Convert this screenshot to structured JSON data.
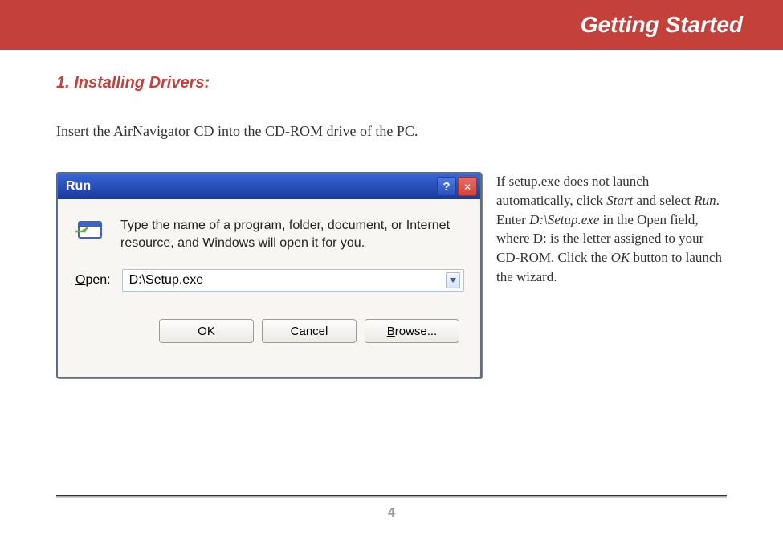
{
  "header": {
    "title": "Getting Started"
  },
  "section": {
    "heading": "1. Installing Drivers:"
  },
  "intro": "Insert the AirNavigator CD into the CD-ROM drive of the PC.",
  "dialog": {
    "title": "Run",
    "help_symbol": "?",
    "close_symbol": "×",
    "message": "Type the name of a program, folder, document, or Internet resource, and Windows will open it for you.",
    "open_label_prefix": "O",
    "open_label_rest": "pen:",
    "open_value": "D:\\Setup.exe",
    "buttons": {
      "ok": "OK",
      "cancel": "Cancel",
      "browse_prefix": "B",
      "browse_rest": "rowse..."
    }
  },
  "side": {
    "t1": "If setup.exe does not launch automatically, click ",
    "i1": "Start",
    "t2": " and select ",
    "i2": "Run",
    "t3": ".  Enter ",
    "i3": "D:\\Setup.exe",
    "t4": " in the Open field, where D: is the letter assigned to your CD-ROM.  Click the ",
    "i4": "OK",
    "t5": " button to launch the wizard."
  },
  "page_number": "4"
}
